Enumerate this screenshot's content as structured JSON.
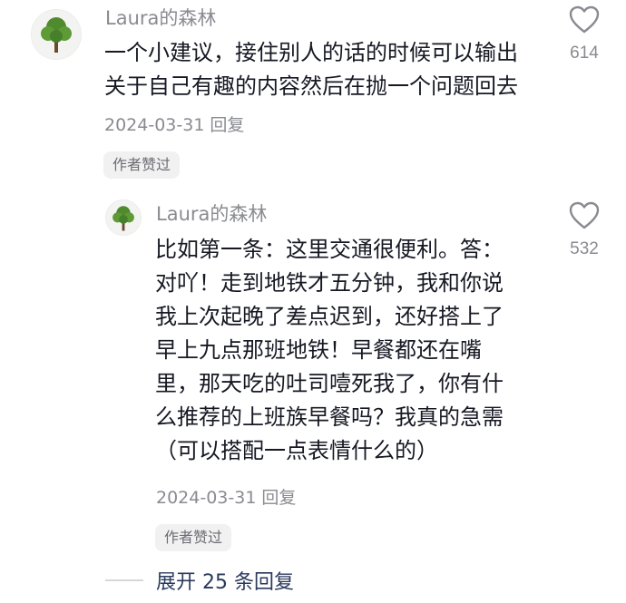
{
  "comments": [
    {
      "username": "Laura的森林",
      "lines": [
        "一个小建议，接住别人的话的时候可以输出",
        "关于自己有趣的内容然后在抛一个问题回去"
      ],
      "date": "2024-03-31",
      "reply_label": "回复",
      "badge": "作者赞过",
      "likes": "614"
    },
    {
      "username": "Laura的森林",
      "lines": [
        "比如第一条：这里交通很便利。答：",
        "对吖！走到地铁才五分钟，我和你说",
        "我上次起晚了差点迟到，还好搭上了",
        "早上九点那班地铁！早餐都还在嘴",
        "里，那天吃的吐司噎死我了，你有什",
        "么推荐的上班族早餐吗？我真的急需",
        "（可以搭配一点表情什么的）"
      ],
      "date": "2024-03-31",
      "reply_label": "回复",
      "badge": "作者赞过",
      "likes": "532"
    }
  ],
  "expand_replies": "展开 25 条回复",
  "icons": {
    "avatar": "tree-icon",
    "like": "heart-outline-icon"
  },
  "colors": {
    "text": "#161823",
    "meta": "#8a8b91",
    "link": "#2b3a5c",
    "badge_bg": "#f1f1f2"
  }
}
